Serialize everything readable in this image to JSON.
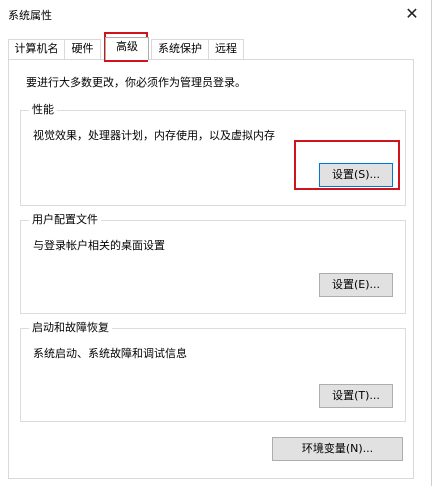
{
  "window": {
    "title": "系统属性",
    "close_label": "✕"
  },
  "tabs": [
    {
      "label": "计算机名"
    },
    {
      "label": "硬件"
    },
    {
      "label": "高级"
    },
    {
      "label": "系统保护"
    },
    {
      "label": "远程"
    }
  ],
  "active_tab": "高级",
  "admin_note": "要进行大多数更改，你必须作为管理员登录。",
  "groups": {
    "performance": {
      "title": "性能",
      "description": "视觉效果，处理器计划，内存使用，以及虚拟内存",
      "button": "设置(S)..."
    },
    "user_profiles": {
      "title": "用户配置文件",
      "description": "与登录帐户相关的桌面设置",
      "button": "设置(E)..."
    },
    "startup_recovery": {
      "title": "启动和故障恢复",
      "description": "系统启动、系统故障和调试信息",
      "button": "设置(T)..."
    }
  },
  "env_button": "环境变量(N)...",
  "colors": {
    "annotation": "#d0141c",
    "focus": "#0078d7",
    "button_bg": "#e1e1e1"
  }
}
